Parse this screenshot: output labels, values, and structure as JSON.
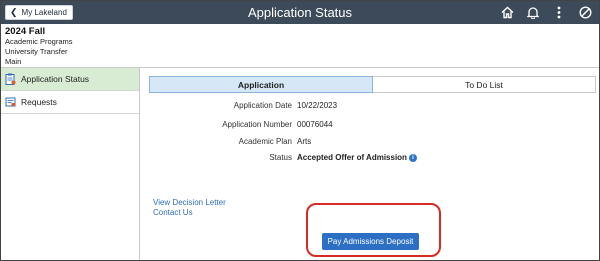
{
  "header": {
    "back_label": "My Lakeland",
    "title": "Application Status",
    "icons": [
      "home-icon",
      "bell-icon",
      "more-vertical-icon",
      "prohibited-icon"
    ]
  },
  "term": {
    "title": "2024 Fall",
    "lines": [
      "Academic Programs",
      "University Transfer",
      "Main"
    ]
  },
  "sidebar": {
    "items": [
      {
        "label": "Application Status",
        "icon": "clipboard-icon",
        "active": true
      },
      {
        "label": "Requests",
        "icon": "request-icon",
        "active": false
      }
    ]
  },
  "tabs": [
    {
      "label": "Application",
      "active": true
    },
    {
      "label": "To Do List",
      "active": false
    }
  ],
  "application": {
    "date_label": "Application Date",
    "date_value": "10/22/2023",
    "number_label": "Application Number",
    "number_value": "00076044",
    "plan_label": "Academic Plan",
    "plan_value": "Arts",
    "status_label": "Status",
    "status_value": "Accepted Offer of Admission"
  },
  "links": {
    "view_decision": "View Decision Letter",
    "contact_us": "Contact Us"
  },
  "actions": {
    "deposit_label": "Pay Admissions Deposit"
  },
  "colors": {
    "header_bg": "#3d4a5a",
    "active_side_bg": "#d8ecd4",
    "active_tab_bg": "#d6e8f7",
    "link": "#2f6fb8",
    "button": "#2c6fc4",
    "highlight": "#d62b24"
  }
}
